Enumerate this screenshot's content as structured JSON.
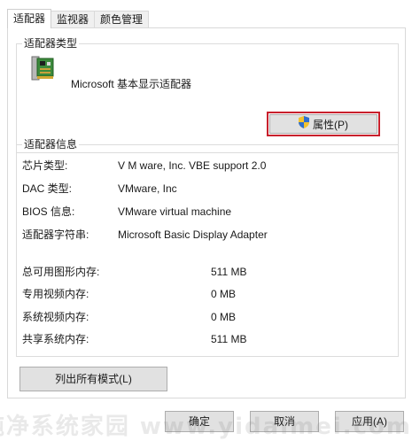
{
  "tabs": [
    {
      "label": "适配器",
      "active": true
    },
    {
      "label": "监视器",
      "active": false
    },
    {
      "label": "颜色管理",
      "active": false
    }
  ],
  "adapter_type": {
    "legend": "适配器类型",
    "name": "Microsoft 基本显示适配器",
    "properties_button": "属性(P)",
    "properties_icon": "uac-shield-icon",
    "highlight_color": "#c8202c"
  },
  "adapter_info": {
    "legend": "适配器信息",
    "rows": [
      {
        "label": "芯片类型:",
        "value": "V M ware, Inc. VBE support 2.0"
      },
      {
        "label": "DAC 类型:",
        "value": "VMware, Inc"
      },
      {
        "label": "BIOS 信息:",
        "value": "VMware virtual machine"
      },
      {
        "label": "适配器字符串:",
        "value": "Microsoft Basic Display Adapter"
      }
    ],
    "memory": [
      {
        "label": "总可用图形内存:",
        "value": "511 MB"
      },
      {
        "label": "专用视频内存:",
        "value": "0 MB"
      },
      {
        "label": "系统视频内存:",
        "value": "0 MB"
      },
      {
        "label": "共享系统内存:",
        "value": "511 MB"
      }
    ]
  },
  "list_modes_button": "列出所有模式(L)",
  "footer": {
    "ok": "确定",
    "cancel": "取消",
    "apply": "应用(A)"
  },
  "watermark": "纯净系统家园 www.yidaimei.com"
}
